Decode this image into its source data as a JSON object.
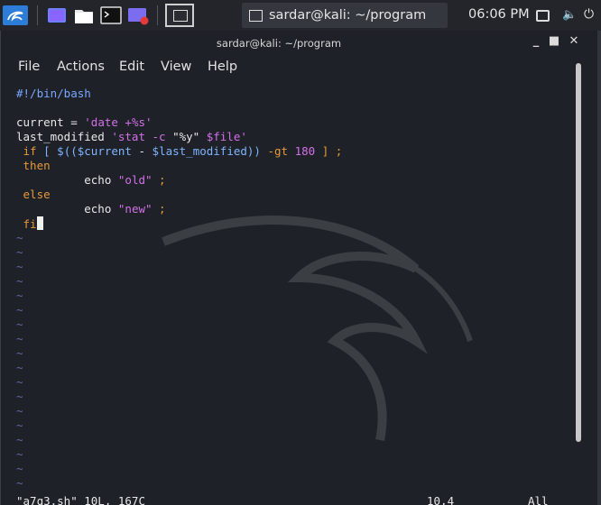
{
  "panel": {
    "icons": [
      "kali-menu-icon",
      "show-desktop-icon",
      "file-manager-icon",
      "terminal-icon",
      "screen-recorder-icon",
      "workspace-switcher-icon"
    ],
    "task_label": "sardar@kali: ~/program",
    "clock": "06:06 PM"
  },
  "window": {
    "title": "sardar@kali: ~/program",
    "menu": {
      "file": "File",
      "actions": "Actions",
      "edit": "Edit",
      "view": "View",
      "help": "Help"
    }
  },
  "editor": {
    "lines": {
      "l1": {
        "shebang": "#!/bin/bash"
      },
      "l3": {
        "a": "current = ",
        "b": "'date +%s'"
      },
      "l4": {
        "a": "last_modified ",
        "b": "'stat -c ",
        "c": "\"%y\"",
        "d": " $file",
        "e": "'"
      },
      "l5": {
        "a": " if ",
        "b": "[ ",
        "c": "$((",
        "d": "$current",
        "e": " - ",
        "f": "$last_modified",
        "g": "))",
        "h": " -gt ",
        "i": "180",
        "j": " ] ;"
      },
      "l6": {
        "a": " then"
      },
      "l7": {
        "a": "          echo ",
        "b": "\"old\"",
        "c": " ;"
      },
      "l8": {
        "a": " else"
      },
      "l9": {
        "a": "          echo ",
        "b": "\"new\"",
        "c": " ;"
      },
      "l10": {
        "a": " fi"
      }
    },
    "tilde": "~",
    "status": {
      "file": "\"a7q3.sh\" 10L, 167C",
      "position": "10,4",
      "scroll": "All"
    }
  },
  "colors": {
    "accent": "#2d7dd8",
    "keyword": "#e59a3a",
    "string": "#d271e8",
    "variable": "#7fb4ff",
    "tilde": "#4f6ea8"
  }
}
